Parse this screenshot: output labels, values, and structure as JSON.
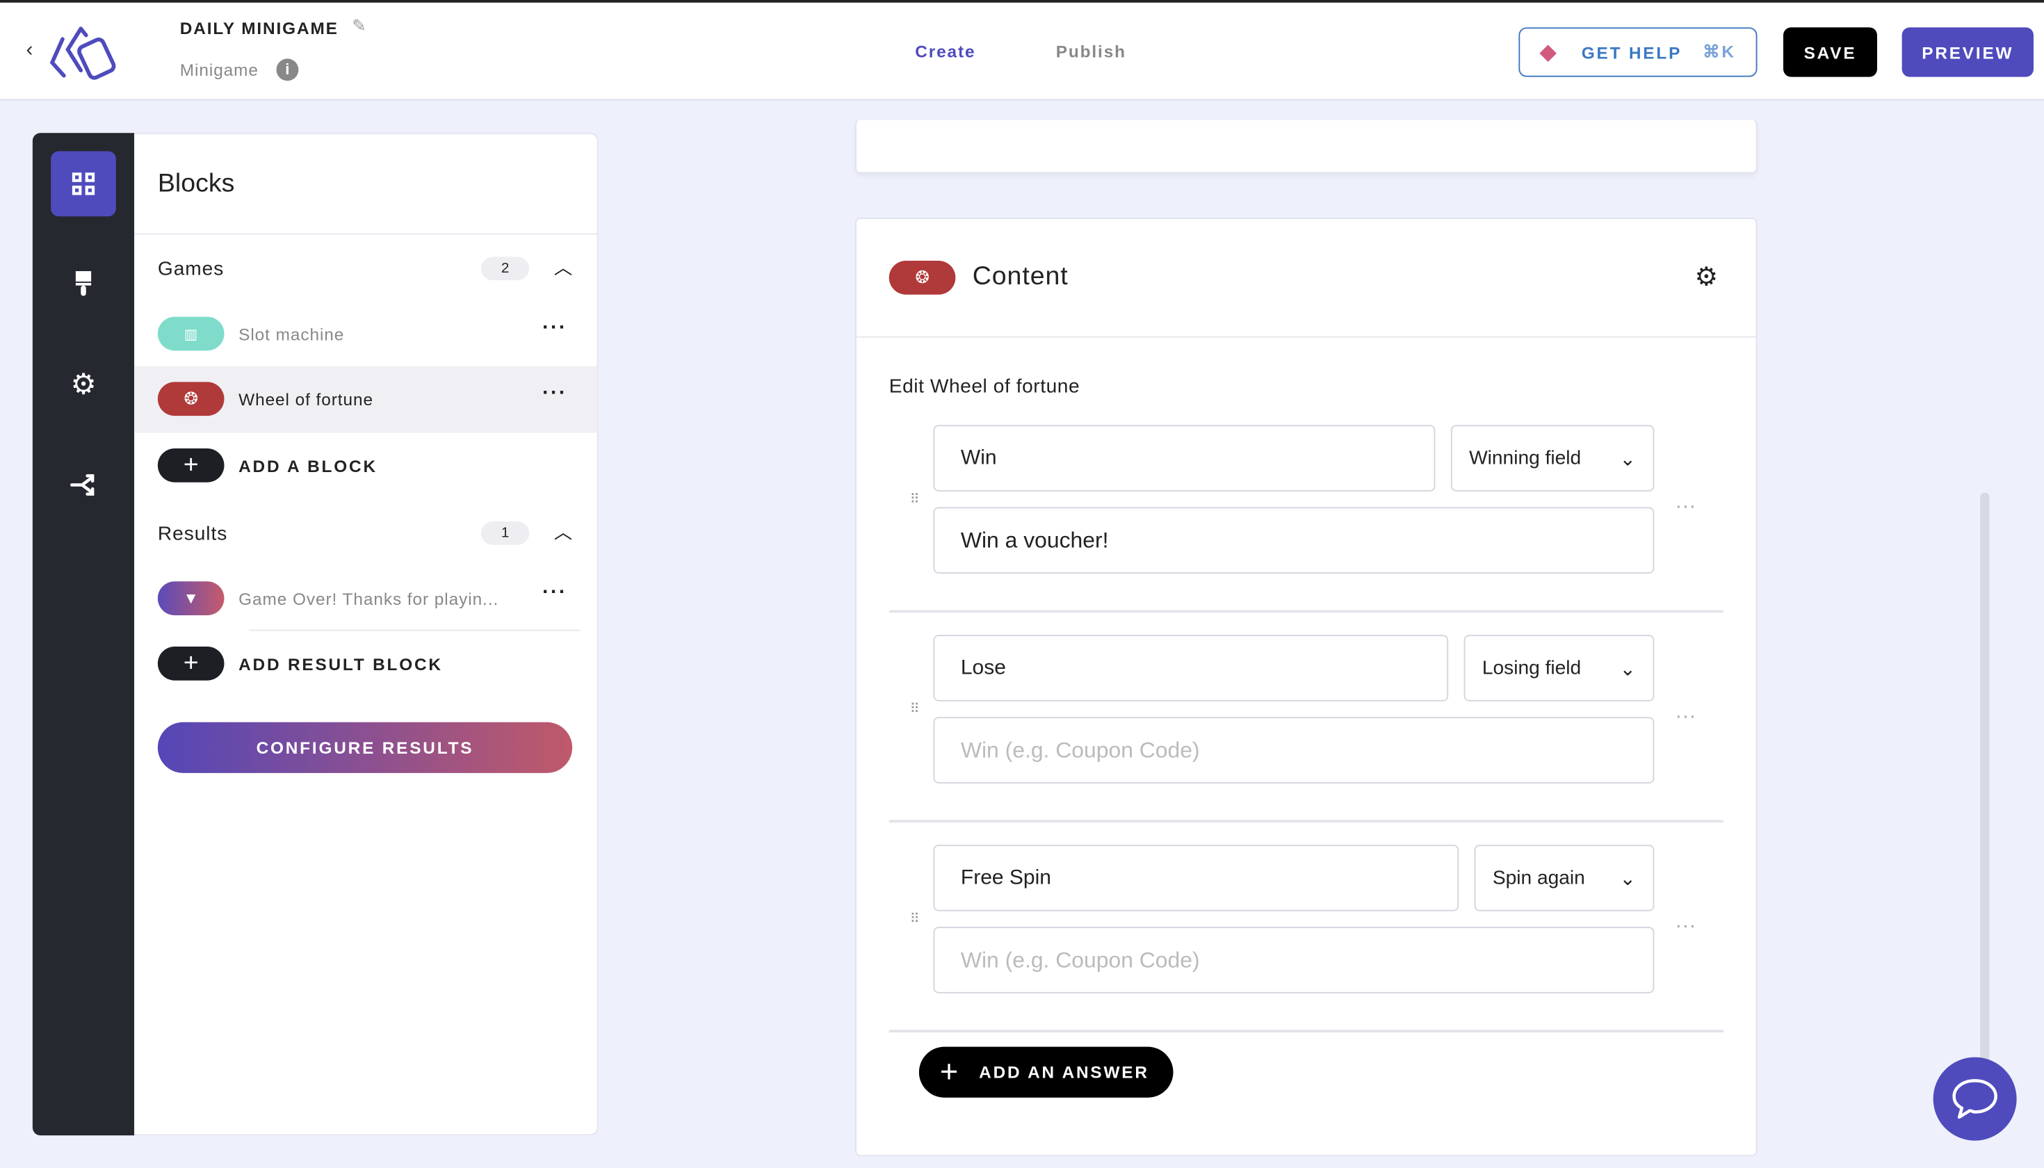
{
  "header": {
    "title": "DAILY MINIGAME",
    "subtitle": "Minigame",
    "tabs": [
      {
        "label": "Create",
        "active": true
      },
      {
        "label": "Publish",
        "active": false
      }
    ],
    "get_help": "GET HELP",
    "shortcut": "⌘K",
    "save": "SAVE",
    "preview": "PREVIEW"
  },
  "colors": {
    "accent": "#4f4bbd",
    "dark": "#262830",
    "slot": "#7fdccb",
    "wheel": "#b0393a",
    "help": "#3b78c2"
  },
  "rail": {
    "items": [
      "blocks",
      "design",
      "settings",
      "flow"
    ]
  },
  "panel": {
    "title": "Blocks",
    "games": {
      "label": "Games",
      "count": "2",
      "items": [
        {
          "label": "Slot machine",
          "icon": "slot-machine-icon"
        },
        {
          "label": "Wheel of fortune",
          "icon": "wheel-icon"
        }
      ],
      "add": "ADD A BLOCK"
    },
    "results": {
      "label": "Results",
      "count": "1",
      "items": [
        {
          "label": "Game Over! Thanks for playin...",
          "icon": "bookmark-icon"
        }
      ],
      "add": "ADD RESULT BLOCK"
    },
    "configure": "CONFIGURE RESULTS"
  },
  "content": {
    "title": "Content",
    "edit_label": "Edit Wheel of fortune",
    "answers": [
      {
        "name": "Win",
        "type": "Winning field",
        "value": "Win a voucher!",
        "placeholder": "Win (e.g. Coupon Code)"
      },
      {
        "name": "Lose",
        "type": "Losing field",
        "value": "",
        "placeholder": "Win (e.g. Coupon Code)"
      },
      {
        "name": "Free Spin",
        "type": "Spin again",
        "value": "",
        "placeholder": "Win (e.g. Coupon Code)"
      }
    ],
    "add_answer": "ADD AN ANSWER"
  }
}
